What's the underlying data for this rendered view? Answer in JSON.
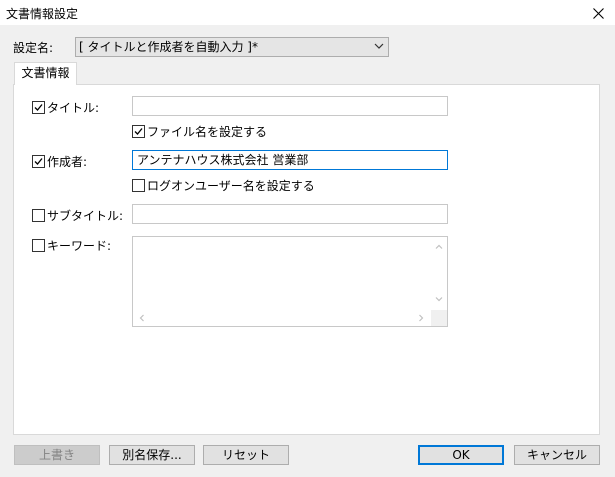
{
  "window": {
    "title": "文書情報設定"
  },
  "settings": {
    "label": "設定名:",
    "selected": "[ タイトルと作成者を自動入力 ]*"
  },
  "tabs": [
    {
      "label": "文書情報",
      "selected": true
    }
  ],
  "fields": {
    "title": {
      "label": "タイトル:",
      "checked": true,
      "value": ""
    },
    "use_filename": {
      "label": "ファイル名を設定する",
      "checked": true
    },
    "author": {
      "label": "作成者:",
      "checked": true,
      "value": "アンテナハウス株式会社  営業部"
    },
    "use_logon_user": {
      "label": "ログオンユーザー名を設定する",
      "checked": false
    },
    "subtitle": {
      "label": "サブタイトル:",
      "checked": false,
      "value": ""
    },
    "keywords": {
      "label": "キーワード:",
      "checked": false,
      "value": ""
    }
  },
  "buttons": {
    "overwrite": "上書き",
    "save_as": "別名保存...",
    "reset": "リセット",
    "ok": "OK",
    "cancel": "キャンセル"
  },
  "colors": {
    "focus_border": "#0078d7",
    "dialog_bg": "#f0f0f0",
    "panel_bg": "#ffffff"
  },
  "icons": {
    "close": "close-icon",
    "dropdown": "chevron-down-icon",
    "check": "checkmark-icon"
  }
}
